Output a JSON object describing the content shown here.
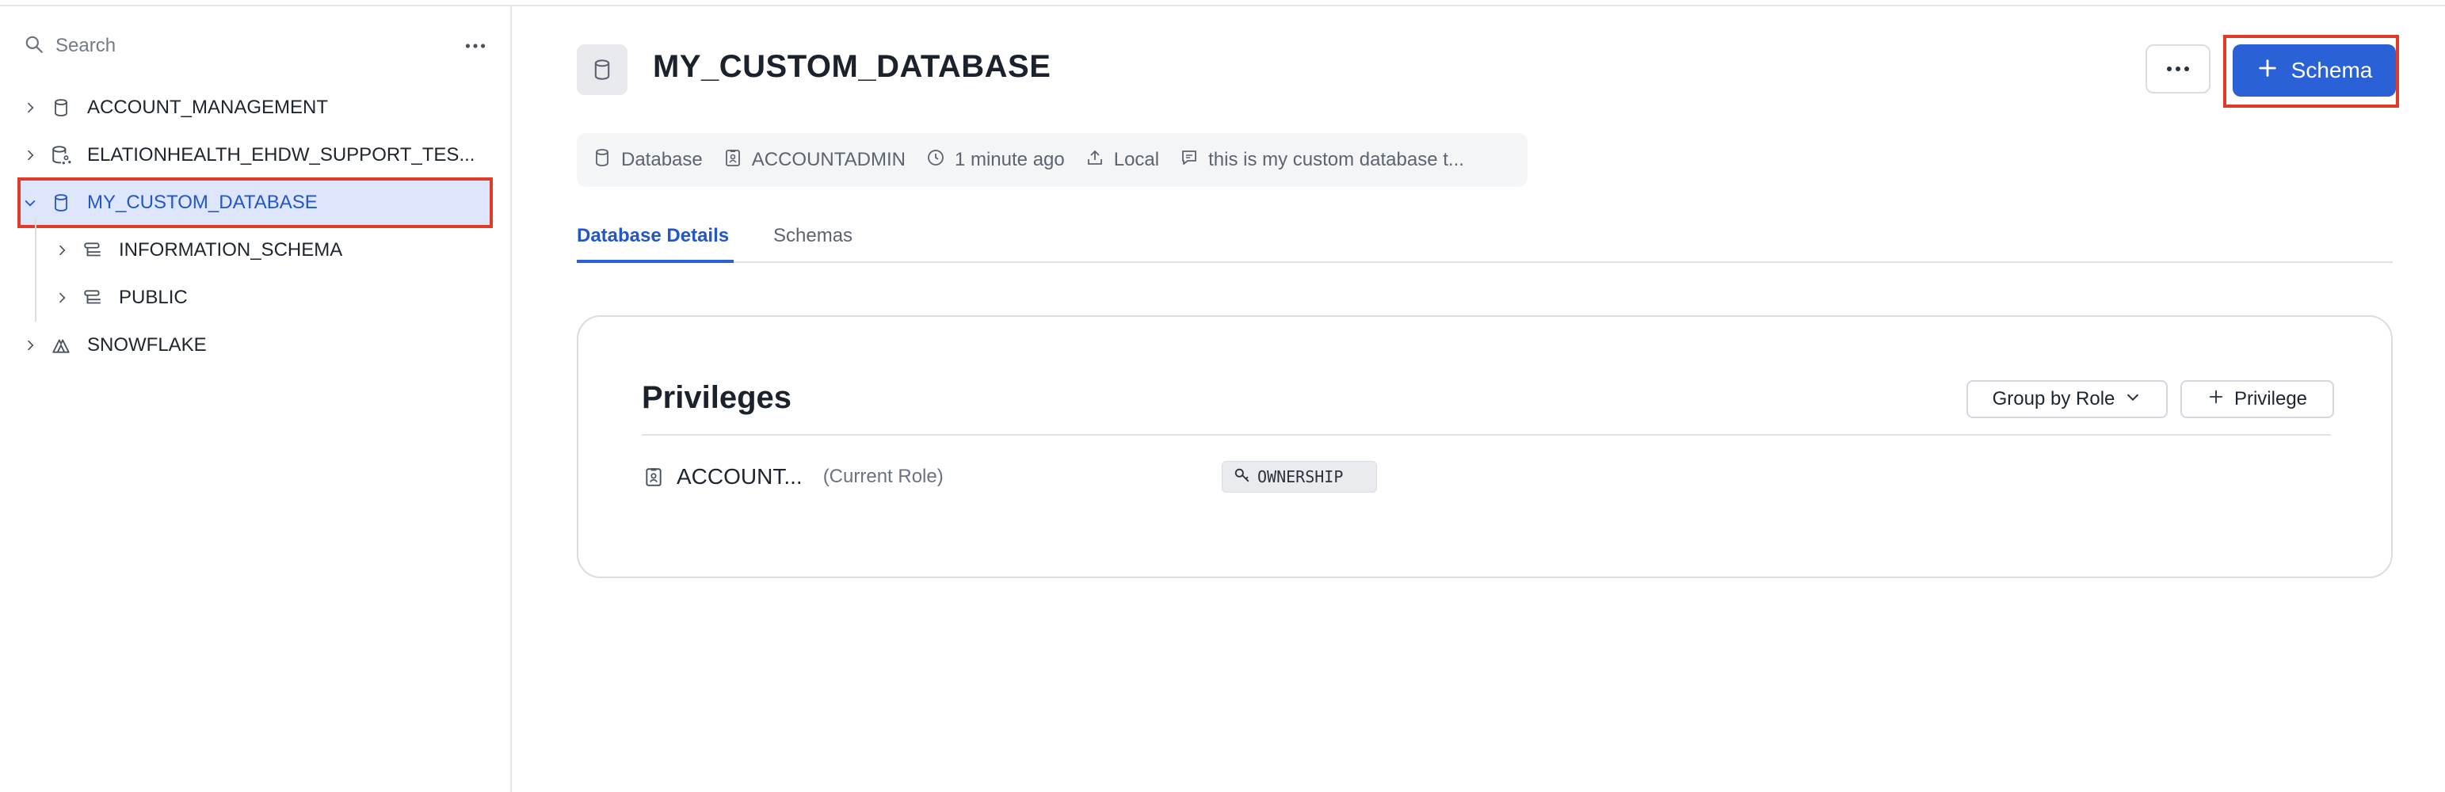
{
  "sidebar": {
    "search_placeholder": "Search",
    "tree": [
      {
        "label": "ACCOUNT_MANAGEMENT",
        "icon": "database-icon",
        "expanded": false
      },
      {
        "label": "ELATIONHEALTH_EHDW_SUPPORT_TES...",
        "icon": "shared-database-icon",
        "expanded": false
      },
      {
        "label": "MY_CUSTOM_DATABASE",
        "icon": "database-icon",
        "expanded": true,
        "selected": true
      },
      {
        "label": "INFORMATION_SCHEMA",
        "icon": "schema-icon",
        "expanded": false,
        "child": true
      },
      {
        "label": "PUBLIC",
        "icon": "schema-icon",
        "expanded": false,
        "child": true
      },
      {
        "label": "SNOWFLAKE",
        "icon": "snowflake-app-icon",
        "expanded": false
      }
    ]
  },
  "header": {
    "title": "MY_CUSTOM_DATABASE",
    "schema_button": "Schema"
  },
  "meta": {
    "type": "Database",
    "owner": "ACCOUNTADMIN",
    "created": "1 minute ago",
    "source": "Local",
    "comment": "this is my custom database t..."
  },
  "tabs": [
    {
      "label": "Database Details",
      "active": true
    },
    {
      "label": "Schemas",
      "active": false
    }
  ],
  "privileges": {
    "title": "Privileges",
    "group_by_label": "Group by Role",
    "add_label": "Privilege",
    "rows": [
      {
        "role": "ACCOUNT...",
        "note": "(Current Role)",
        "privilege": "OWNERSHIP"
      }
    ]
  },
  "colors": {
    "accent": "#2a61d6",
    "highlight_border": "#e13a26",
    "selected_bg": "#dde6fb"
  }
}
